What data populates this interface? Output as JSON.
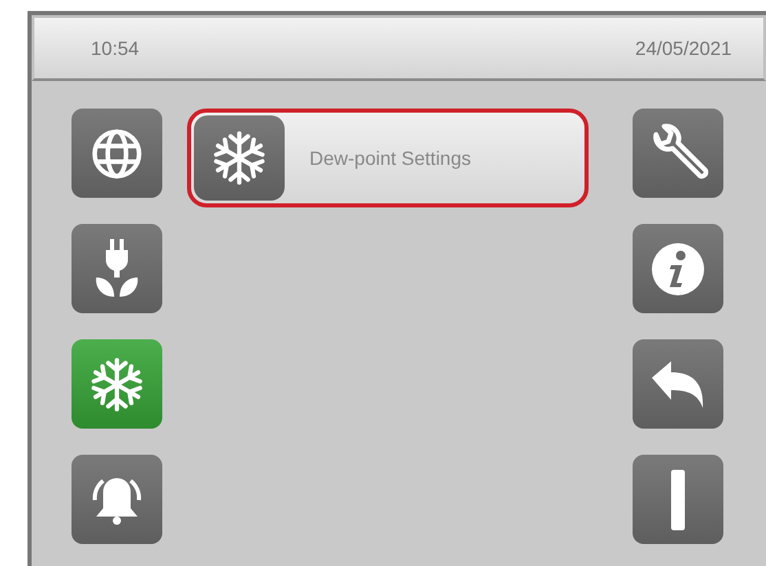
{
  "status_bar": {
    "time": "10:54",
    "date": "24/05/2021"
  },
  "left_buttons": [
    {
      "kind": "globe",
      "selected": false
    },
    {
      "kind": "plug",
      "selected": false
    },
    {
      "kind": "snowflake",
      "selected": true
    },
    {
      "kind": "bell",
      "selected": false
    }
  ],
  "menu_items": [
    {
      "kind": "snowflake",
      "label": "Dew-point Settings",
      "selected": true
    }
  ],
  "right_buttons": [
    {
      "kind": "wrench"
    },
    {
      "kind": "info"
    },
    {
      "kind": "back"
    },
    {
      "kind": "power"
    }
  ]
}
